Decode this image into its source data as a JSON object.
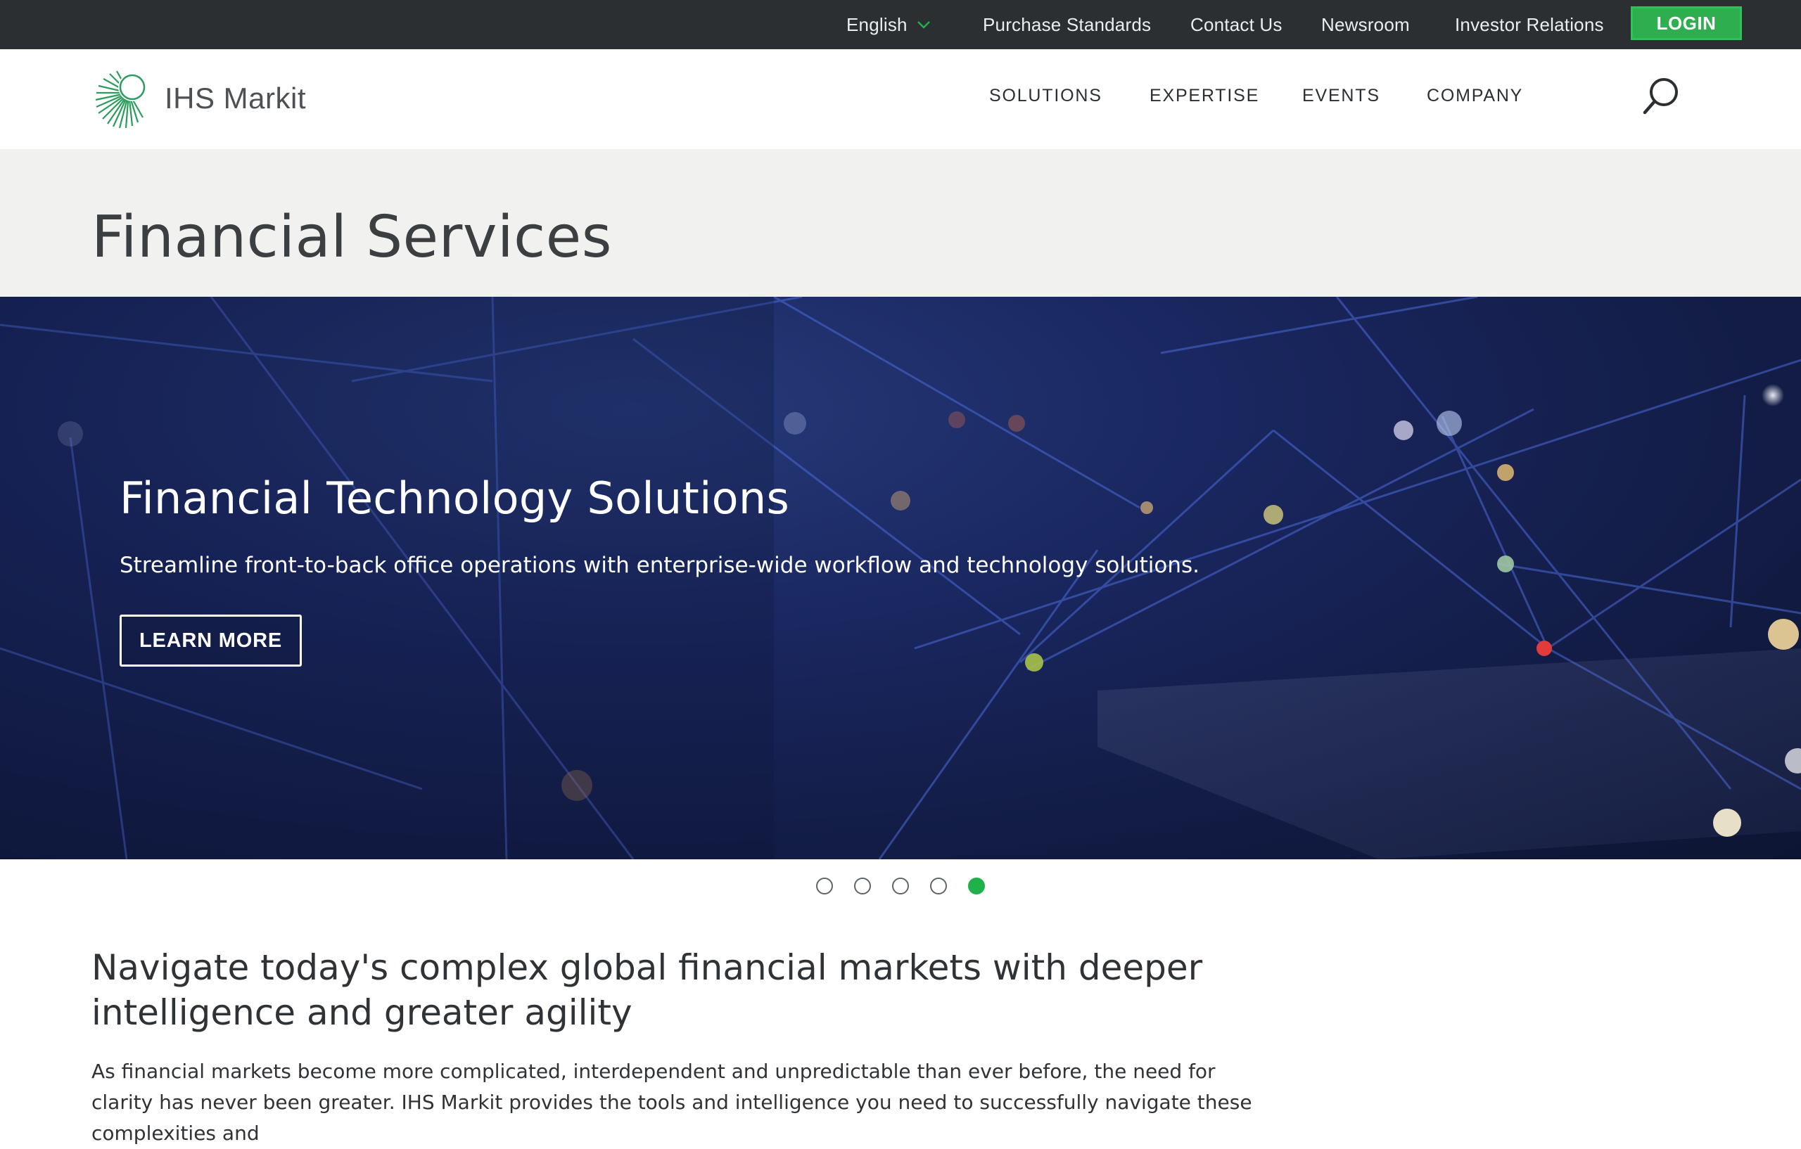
{
  "utility_bar": {
    "language": "English",
    "purchase_standards": "Purchase Standards",
    "contact_us": "Contact Us",
    "newsroom": "Newsroom",
    "investor_relations": "Investor Relations",
    "login": "LOGIN"
  },
  "header": {
    "logo_text": "IHS Markit",
    "nav": [
      "SOLUTIONS",
      "EXPERTISE",
      "EVENTS",
      "COMPANY"
    ]
  },
  "page": {
    "title": "Financial Services"
  },
  "hero": {
    "title": "Financial Technology Solutions",
    "subtitle": "Streamline front-to-back office operations with enterprise-wide workflow and technology solutions.",
    "cta": "LEARN MORE"
  },
  "carousel": {
    "slide_count": 5,
    "active_index": 4
  },
  "intro": {
    "heading": "Navigate today's complex global financial markets with deeper intelligence and greater agility",
    "body": "As financial markets become more complicated, interdependent and unpredictable than ever before, the need for clarity has never been greater. IHS Markit provides the tools and intelligence you need to successfully navigate these complexities and"
  },
  "colors": {
    "utility_bg": "#2b2f31",
    "accent_green": "#20b24a",
    "hero_bg": "#1a2760",
    "title_band_bg": "#f1f1f0"
  }
}
